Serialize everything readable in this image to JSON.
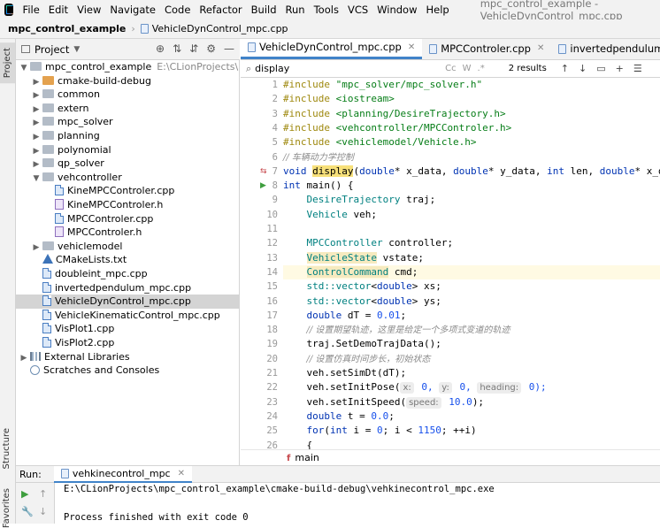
{
  "menubar": {
    "items": [
      "File",
      "Edit",
      "View",
      "Navigate",
      "Code",
      "Refactor",
      "Build",
      "Run",
      "Tools",
      "VCS",
      "Window",
      "Help"
    ],
    "title": "mpc_control_example - VehicleDynControl_mpc.cpp"
  },
  "navbar": {
    "project": "mpc_control_example",
    "file": "VehicleDynControl_mpc.cpp"
  },
  "left_stripe": {
    "project": "Project",
    "structure": "Structure",
    "favorites": "Favorites"
  },
  "project_panel": {
    "title": "Project",
    "rows": [
      {
        "label": "mpc_control_example",
        "path": "E:\\CLionProjects\\mpc_co"
      },
      {
        "label": "cmake-build-debug"
      },
      {
        "label": "common"
      },
      {
        "label": "extern"
      },
      {
        "label": "mpc_solver"
      },
      {
        "label": "planning"
      },
      {
        "label": "polynomial"
      },
      {
        "label": "qp_solver"
      },
      {
        "label": "vehcontroller"
      },
      {
        "label": "KineMPCControler.cpp"
      },
      {
        "label": "KineMPCControler.h"
      },
      {
        "label": "MPCControler.cpp"
      },
      {
        "label": "MPCControler.h"
      },
      {
        "label": "vehiclemodel"
      },
      {
        "label": "CMakeLists.txt"
      },
      {
        "label": "doubleint_mpc.cpp"
      },
      {
        "label": "invertedpendulum_mpc.cpp"
      },
      {
        "label": "VehicleDynControl_mpc.cpp"
      },
      {
        "label": "VehicleKinematicControl_mpc.cpp"
      },
      {
        "label": "VisPlot1.cpp"
      },
      {
        "label": "VisPlot2.cpp"
      },
      {
        "label": "External Libraries"
      },
      {
        "label": "Scratches and Consoles"
      }
    ]
  },
  "tabs": [
    "VehicleDynControl_mpc.cpp",
    "MPCControler.cpp",
    "invertedpendulum_mpc.cpp"
  ],
  "search": {
    "value": "display",
    "results": "2 results",
    "opt_case": "Cc",
    "opt_word": "W",
    "opt_regex": ".*"
  },
  "editor": {
    "lines": [
      "1",
      "2",
      "3",
      "4",
      "5",
      "6",
      "7",
      "8",
      "9",
      "10",
      "11",
      "12",
      "13",
      "14",
      "15",
      "16",
      "17",
      "18",
      "19",
      "20",
      "21",
      "22",
      "23",
      "24",
      "25",
      "26"
    ],
    "tokens": {
      "include": "#include",
      "inc1": "\"mpc_solver/mpc_solver.h\"",
      "inc2": "<iostream>",
      "inc3": "<planning/DesireTrajectory.h>",
      "inc4": "<vehcontroller/MPCControler.h>",
      "inc5": "<vehiclemodel/Vehicle.h>",
      "cmt6": "// 车辆动力学控制",
      "l7_void": "void",
      "l7_fn": "display",
      "l7_rest1": "(",
      "l7_double": "double",
      "l7_a": "* x_data, ",
      "l7_b": "* y_data, ",
      "l7_int": "int",
      "l7_c": " len, ",
      "l7_d": "* x_data",
      "l8_int": "int",
      "l8_rest": " main() {",
      "l9_t": "DesireTrajectory",
      "l9_v": " traj;",
      "l10_t": "Vehicle",
      "l10_v": " veh;",
      "l12_t": "MPCController",
      "l12_v": " controller;",
      "l13_t": "VehicleState",
      "l13_v": " vstate;",
      "l14_t": "ControlCommand",
      "l14_v": " cmd;",
      "std": "std",
      "vector": "::vector",
      "lt": "<",
      "dbl": "double",
      "l15_v": "> xs;",
      "l16_v": "> ys;",
      "l17_a": " dT = ",
      "l17_num": "0.01",
      "semi": ";",
      "cmt18": "// 设置期望轨迹，这里是给定一个多项式变道的轨迹",
      "l19": "traj.SetDemoTrajData();",
      "cmt20": "// 设置仿真时间步长，初始状态",
      "l21_a": "veh.setSimDt(dT);",
      "l22_a": "veh.setInitPose(",
      "hint_x": "x:",
      "l22_b": " 0, ",
      "hint_y": "y:",
      "l22_c": " 0, ",
      "hint_h": "heading:",
      "l22_d": " 0);",
      "l23_a": "veh.setInitSpeed(",
      "hint_s": "speed:",
      "l23_num": " 10.0",
      "l23_b": ");",
      "l24_a": " t = ",
      "l24_num": "0.0",
      "l25_for": "for",
      "l25_a": "(",
      "l25_b": " i = ",
      "l25_c": "0",
      "l25_d": "; i < ",
      "l25_e": "1150",
      "l25_f": "; ++i)",
      "l26": "{"
    }
  },
  "breadcrumb_bottom": {
    "icon": "f",
    "label": "main"
  },
  "run_panel": {
    "label": "Run:",
    "tab": "vehkinecontrol_mpc",
    "console": [
      "E:\\CLionProjects\\mpc_control_example\\cmake-build-debug\\vehkinecontrol_mpc.exe",
      "Process finished with exit code 0"
    ]
  },
  "colors": {
    "accent": "#4083c9",
    "keyword": "#0033b3",
    "string": "#067d17",
    "preprocessor": "#9e880d",
    "type": "#008080",
    "number": "#1750eb"
  }
}
